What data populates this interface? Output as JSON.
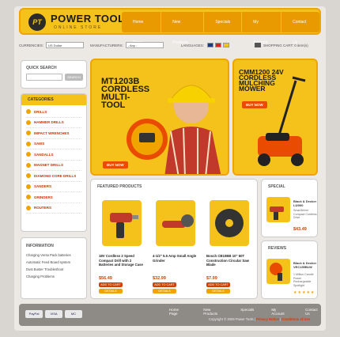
{
  "brand": {
    "badge": "PT",
    "title": "POWER TOOLS",
    "subtitle": "ONLINE STORE"
  },
  "topnav": [
    "Home Page",
    "New Products",
    "Specials",
    "My Account",
    "Contact Us"
  ],
  "util": {
    "currencies_label": "CURRENCIES:",
    "currencies_value": "US Dollar",
    "manufacturers_label": "MANUFACTURERS:",
    "manufacturers_value": "- Any -",
    "languages_label": "LANGUAGES:",
    "cart_label": "SHOPPING CART: 0 item(s)"
  },
  "search": {
    "title": "QUICK SEARCH",
    "button": "SEARCH",
    "placeholder": ""
  },
  "categories": {
    "title": "CATEGORIES",
    "items": [
      "DRILLS",
      "HAMMER DRILLS",
      "IMPACT WRENCHES",
      "SAWS",
      "SANDALLS",
      "MAGNET DRILLS",
      "DIAMOND CORE DRILLS",
      "SANDERS",
      "GRINDERS",
      "ROUTERS"
    ]
  },
  "information": {
    "title": "INFORMATION",
    "items": [
      "Charging Versa Pack batteries",
      "Automatic Feed Board system",
      "Dust Buster Troubleshoot",
      "Charging Problems"
    ]
  },
  "banner1": {
    "title": "MT1203B CORDLESS MULTI-TOOL",
    "buy": "BUY NOW"
  },
  "banner2": {
    "title": "CMM1200 24V CORDLESS MULCHING MOWER",
    "buy": "BUY NOW"
  },
  "featured": {
    "title": "FEATURED PRODUCTS",
    "products": [
      {
        "name": "18V Cordless 2 Speed Compact Drill with 2 Batteries and Storage Case",
        "price": "$56.49",
        "cart": "ADD TO CART",
        "details": "DETAILS"
      },
      {
        "name": "4-1/2\" 5.5 Amp Small Angle Grinder",
        "price": "$32.99",
        "cart": "ADD TO CART",
        "details": "DETAILS"
      },
      {
        "name": "Bosch CB10BB 10\" 60T Construction Circular Saw Blade",
        "price": "$7.99",
        "cart": "ADD TO CART",
        "details": "DETAILS"
      }
    ]
  },
  "special": {
    "title": "SPECIAL",
    "name": "Black & Decker LI2000",
    "desc": "SmartDriver Compact Cordless Drive",
    "price": "$43.49"
  },
  "reviews": {
    "title": "REVIEWS",
    "name": "Black & Decker VEC155BLW",
    "desc": "1 Million Candle Power Rechargeable Spotlight",
    "stars": "★★★★★"
  },
  "footer": {
    "payments": [
      "PayPal",
      "VISA",
      "MC"
    ],
    "nav": [
      "Home Page",
      "New Products",
      "Specials",
      "My Account",
      "Contact Us"
    ],
    "copyright": "Copyright © 2009 Power Tools",
    "privacy": "Privacy Notice",
    "conditions": "Conditions of Use"
  }
}
